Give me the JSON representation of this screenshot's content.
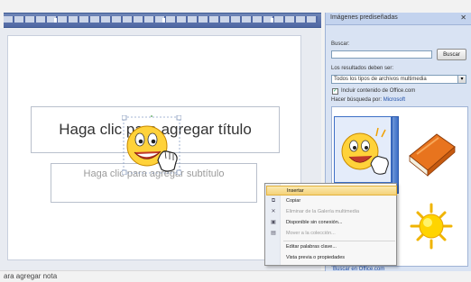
{
  "editor": {
    "title_placeholder": "Haga clic para agregar título",
    "subtitle_placeholder": "Haga clic para agregar subtítulo"
  },
  "status_bar": {
    "text": "ara agregar nota"
  },
  "task_pane": {
    "title": "Imágenes prediseñadas",
    "close_icon": "close-icon",
    "search_label": "Buscar:",
    "search_value": "",
    "search_button": "Buscar",
    "results_label": "Los resultados deben ser:",
    "results_type_value": "Todos los tipos de archivos multimedia",
    "include_office_label": "Incluir contenido de Office.com",
    "include_office_checked": true,
    "help_text": "Hacer búsqueda por:",
    "help_link": "Microsoft",
    "clips": [
      {
        "name": "smiley-hand-clip",
        "selected": true
      },
      {
        "name": "book-clip",
        "selected": false
      },
      {
        "name": "misc-clip",
        "selected": false
      },
      {
        "name": "sun-clip",
        "selected": false
      }
    ],
    "bottom_link": "Buscar en Office.com"
  },
  "context_menu": {
    "items": [
      {
        "label": "Insertar",
        "icon": "",
        "highlighted": true,
        "disabled": false
      },
      {
        "label": "Copiar",
        "icon": "copy-icon",
        "highlighted": false,
        "disabled": false
      },
      {
        "label": "Eliminar de la Galería multimedia",
        "icon": "delete-icon",
        "highlighted": false,
        "disabled": true
      },
      {
        "label": "Disponible sin conexión...",
        "icon": "offline-icon",
        "highlighted": false,
        "disabled": false
      },
      {
        "label": "Mover a la colección...",
        "icon": "move-icon",
        "highlighted": false,
        "disabled": true
      },
      {
        "label": "Editar palabras clave...",
        "icon": "",
        "highlighted": false,
        "disabled": false
      },
      {
        "label": "Vista previa o propiedades",
        "icon": "",
        "highlighted": false,
        "disabled": false
      }
    ]
  },
  "colors": {
    "ribbon_blue": "#4f67a3",
    "pane_bg": "#d9e3f3",
    "highlight": "#f4d27a",
    "link": "#1f4ea8"
  }
}
